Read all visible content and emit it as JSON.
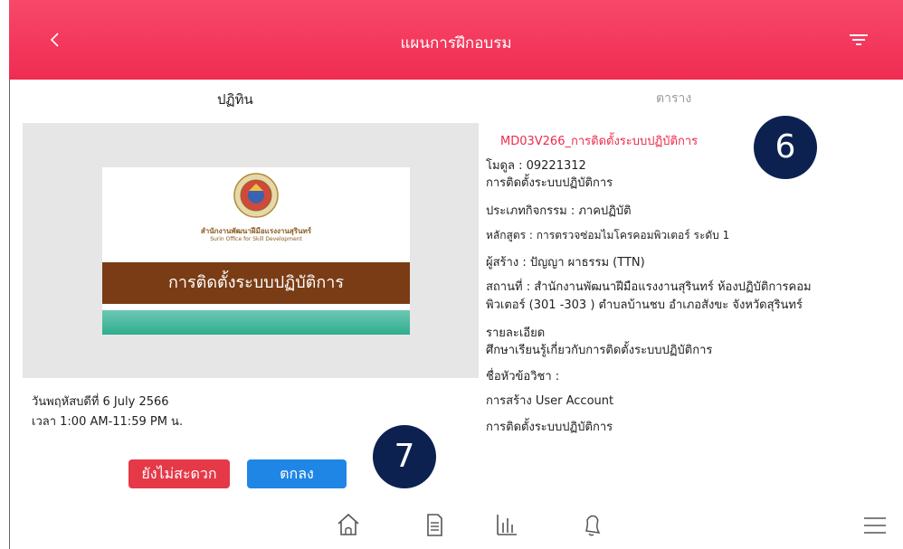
{
  "header": {
    "title": "แผนการฝึกอบรม"
  },
  "tabs": [
    {
      "label": "ปฏิทิน"
    },
    {
      "label": "ตาราง"
    }
  ],
  "cover": {
    "org_th": "สำนักงานพัฒนาฝีมือแรงงานสุรินทร์",
    "org_en": "Surin Office for Skill Development",
    "title": "การติดตั้งระบบปฏิบัติการ"
  },
  "schedule": {
    "date": "วันพฤหัสบดีที่ 6 July 2566",
    "time": "เวลา 1:00 AM-11:59 PM น."
  },
  "details": {
    "course_code": "MD03V266_การติดตั้งระบบปฏิบัติการ",
    "module": "โมดูล : 09221312",
    "module_name": "การติดตั้งระบบปฏิบัติการ",
    "activity_type": "ประเภทกิจกรรม : ภาคปฏิบัติ",
    "curriculum": "หลักสูตร : การตรวจซ่อมไมโครคอมพิวเตอร์ ระดับ 1",
    "creator": "ผู้สร้าง : ปัญญา ผาธรรม (TTN)",
    "location_1": "สถานที่ : สำนักงานพัฒนาฝีมือแรงงานสุรินทร์ ห้องปฏิบัติการคอม",
    "location_2": "พิวเตอร์ (301 -303 ) ตำบลบ้านชบ อำเภอสังขะ  จังหวัดสุรินทร์",
    "description_label": "รายละเอียด",
    "description": "ศึกษาเรียนรู้เกี่ยวกับการติดตั้งระบบปฏิบัติการ",
    "topics_label": "ชื่อหัวข้อวิชา :",
    "topics": [
      "การสร้าง User Account",
      "การติดตั้งระบบปฏิบัติการ"
    ]
  },
  "badges": {
    "six": "6",
    "seven": "7"
  },
  "buttons": {
    "later": "ยังไม่สะดวก",
    "ok": "ตกลง"
  },
  "colors": {
    "header": "#f23a5e",
    "accent_text": "#ec2b4f",
    "later_button": "#e53948",
    "ok_button": "#1f86e6",
    "badge": "#0d2151"
  },
  "bottom_nav": {
    "icons": [
      "home-icon",
      "document-icon",
      "chart-icon",
      "bell-icon",
      "menu-icon"
    ]
  }
}
